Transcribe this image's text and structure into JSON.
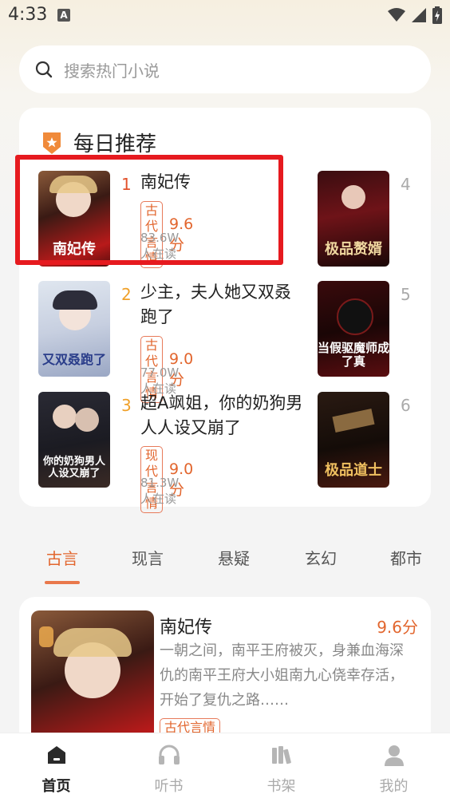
{
  "status": {
    "time": "4:33",
    "badge": "A"
  },
  "search": {
    "placeholder": "搜索热门小说"
  },
  "daily": {
    "title": "每日推荐",
    "books": [
      {
        "rank": "1",
        "title": "南妃传",
        "tag": "古代言情",
        "score": "9.6分",
        "readers": "83.6W人在读",
        "cover_text": "南妃传"
      },
      {
        "rank": "2",
        "title": "少主，夫人她又双叒跑了",
        "tag": "古代言情",
        "score": "9.0分",
        "readers": "77.0W人在读",
        "cover_text": "又双叒跑了"
      },
      {
        "rank": "3",
        "title": "超A飒姐，你的奶狗男人人设又崩了",
        "tag": "现代言情",
        "score": "9.0分",
        "readers": "81.3W人在读",
        "cover_text": "你的奶狗男人人设又崩了"
      },
      {
        "rank": "4",
        "cover_text": "极品赘婿"
      },
      {
        "rank": "5",
        "cover_text": "当假驱魔师成了真"
      },
      {
        "rank": "6",
        "cover_text": "极品道士"
      }
    ]
  },
  "tabs": [
    "古言",
    "现言",
    "悬疑",
    "玄幻",
    "都市"
  ],
  "feature": {
    "title": "南妃传",
    "score": "9.6分",
    "desc": "一朝之间，南平王府被灭，身兼血海深仇的南平王府大小姐南九心侥幸存活，开始了复仇之路……",
    "tag": "古代言情"
  },
  "nav": [
    {
      "label": "首页",
      "icon": "home-icon",
      "active": true
    },
    {
      "label": "听书",
      "icon": "headphones-icon",
      "active": false
    },
    {
      "label": "书架",
      "icon": "bookshelf-icon",
      "active": false
    },
    {
      "label": "我的",
      "icon": "user-icon",
      "active": false
    }
  ],
  "colors": {
    "accent": "#e2662e",
    "highlight": "#e61a1f"
  }
}
